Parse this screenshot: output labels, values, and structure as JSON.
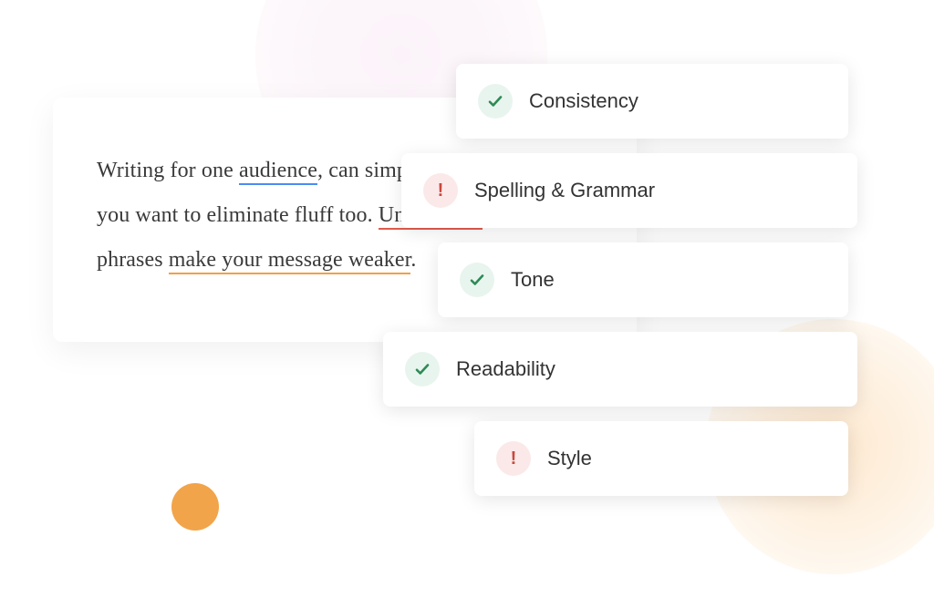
{
  "text_card": {
    "segments": [
      {
        "t": "Writing for one "
      },
      {
        "t": "audience",
        "u": "blue"
      },
      {
        "t": ", can simplify your copy. But you want to eliminate fluff too. "
      },
      {
        "t": "Unnecesary",
        "u": "red"
      },
      {
        "t": " words and phrases "
      },
      {
        "t": "make your message weaker",
        "u": "orange"
      },
      {
        "t": "."
      }
    ]
  },
  "checks": [
    {
      "label": "Consistency",
      "status": "pass"
    },
    {
      "label": "Spelling & Grammar",
      "status": "fail"
    },
    {
      "label": "Tone",
      "status": "pass"
    },
    {
      "label": "Readability",
      "status": "pass"
    },
    {
      "label": "Style",
      "status": "fail"
    }
  ],
  "colors": {
    "underline_blue": "#4a8cf4",
    "underline_red": "#e35a4b",
    "underline_orange": "#f0a048",
    "pass_icon_bg": "#e8f5ee",
    "pass_icon_fg": "#2e8a57",
    "fail_icon_bg": "#fbe9e9",
    "fail_icon_fg": "#c9483e",
    "dot_orange": "#f2a44a"
  }
}
